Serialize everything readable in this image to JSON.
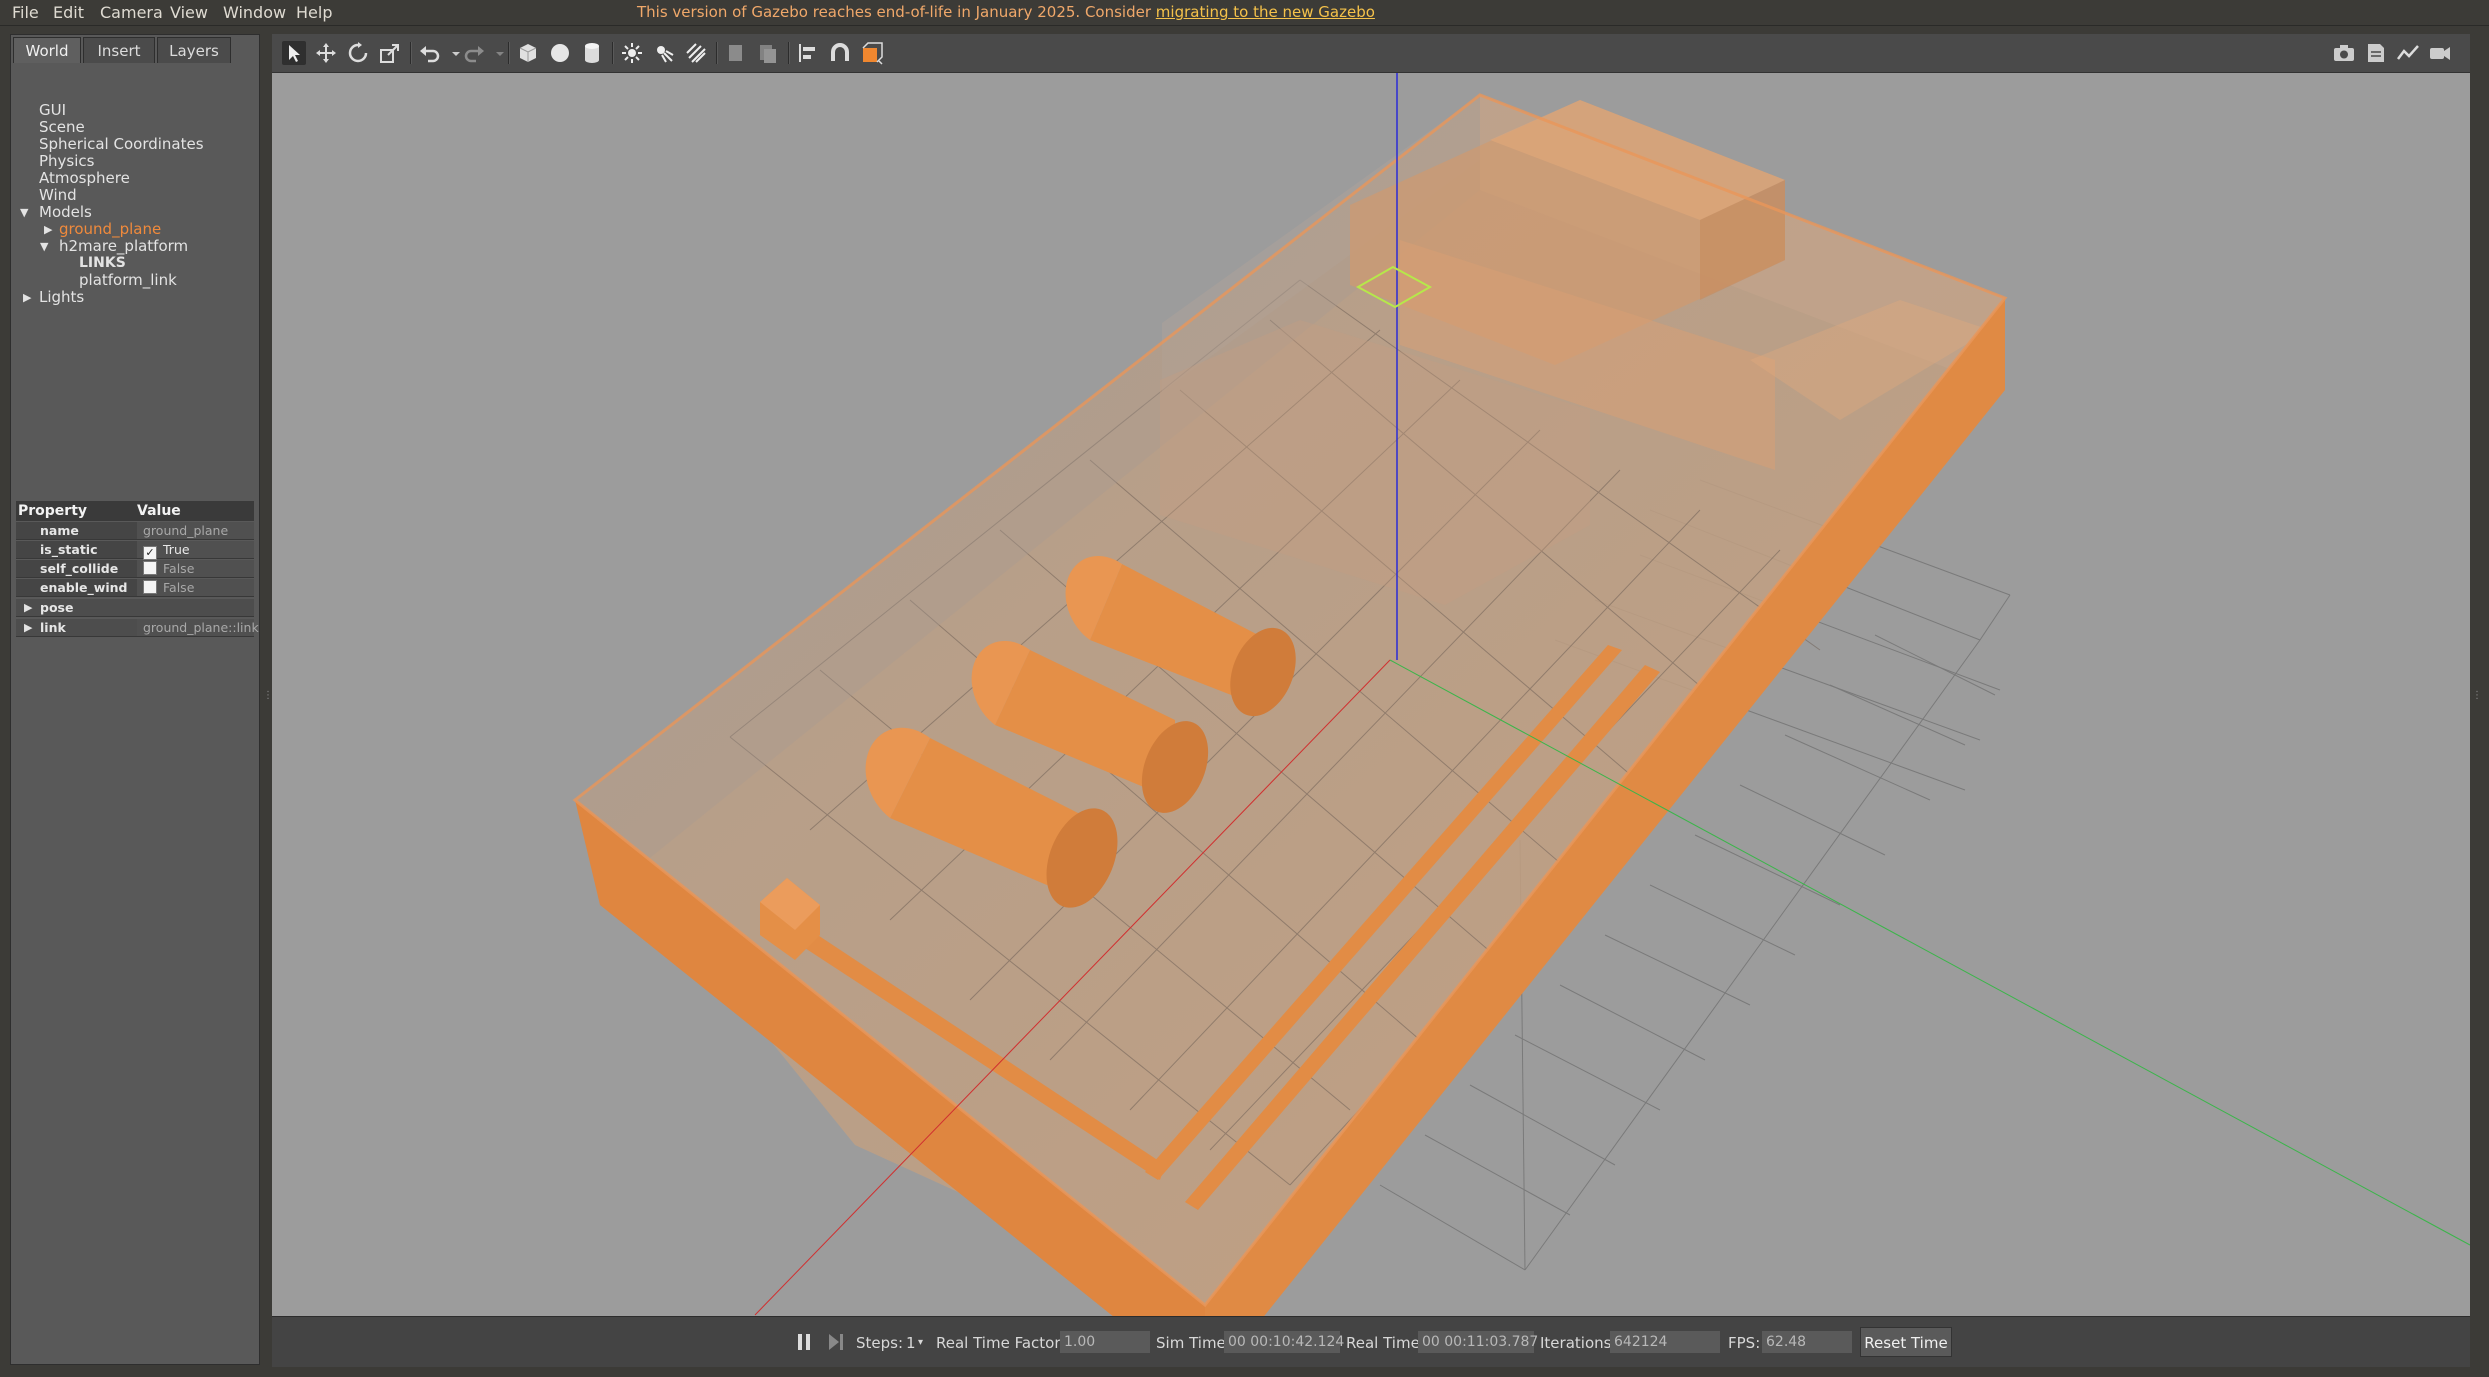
{
  "menu": [
    "File",
    "Edit",
    "Camera",
    "View",
    "Window",
    "Help"
  ],
  "notice": {
    "text": "This version of Gazebo reaches end-of-life in January 2025. Consider ",
    "link": "migrating to the new Gazebo"
  },
  "tabs": [
    "World",
    "Insert",
    "Layers"
  ],
  "tree": {
    "gui": "GUI",
    "scene": "Scene",
    "spherical": "Spherical Coordinates",
    "physics": "Physics",
    "atmosphere": "Atmosphere",
    "wind": "Wind",
    "models": "Models",
    "ground_plane": "ground_plane",
    "platform": "h2mare_platform",
    "links": "LINKS",
    "platform_link": "platform_link",
    "lights": "Lights"
  },
  "props": {
    "header_property": "Property",
    "header_value": "Value",
    "name_key": "name",
    "name_val": "ground_plane",
    "static_key": "is_static",
    "static_val": "True",
    "collide_key": "self_collide",
    "collide_val": "False",
    "wind_key": "enable_wind",
    "wind_val": "False",
    "pose_key": "pose",
    "link_key": "link",
    "link_val": "ground_plane::link"
  },
  "status": {
    "steps_label": "Steps:",
    "steps_val": "1",
    "rtf_label": "Real Time Factor:",
    "rtf_val": "1.00",
    "sim_label": "Sim Time:",
    "sim_val": "00 00:10:42.124",
    "real_label": "Real Time:",
    "real_val": "00 00:11:03.787",
    "iter_label": "Iterations:",
    "iter_val": "642124",
    "fps_label": "FPS:",
    "fps_val": "62.48",
    "reset_label": "Reset Time"
  },
  "colors": {
    "accent": "#f08a3c",
    "model_orange": "#e8914a",
    "viewport_bg": "#9c9c9c"
  },
  "icons": [
    "select-icon",
    "translate-icon",
    "rotate-icon",
    "scale-icon",
    "undo-icon",
    "redo-icon",
    "box-icon",
    "sphere-icon",
    "cylinder-icon",
    "point-light-icon",
    "spot-light-icon",
    "directional-light-icon",
    "copy-icon",
    "paste-icon",
    "align-icon",
    "snap-icon",
    "view-angle-icon",
    "screenshot-icon",
    "log-icon",
    "plot-icon",
    "record-icon",
    "pause-icon",
    "step-icon"
  ]
}
